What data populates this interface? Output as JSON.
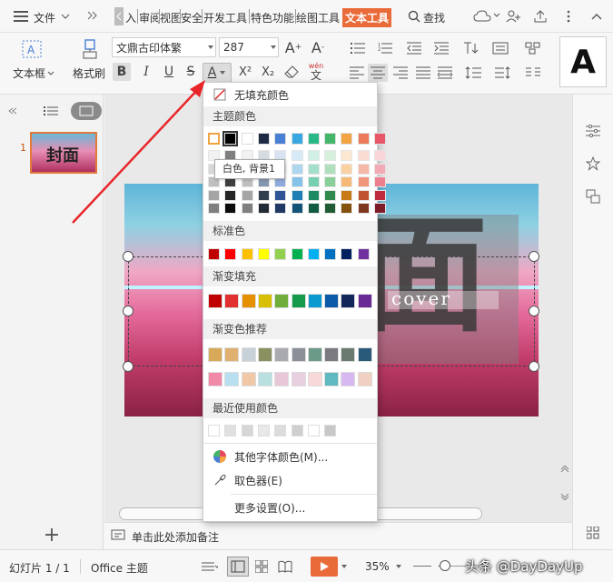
{
  "menubar": {
    "file_label": "文件",
    "tabs": [
      "入",
      "审阅",
      "视图",
      "安全",
      "开发工具",
      "特色功能",
      "绘图工具"
    ],
    "active_tab": "文本工具",
    "search_label": "查找"
  },
  "ribbon": {
    "textbox_label": "文本框",
    "format_painter_label": "格式刷",
    "font_name": "文鼎古印体繁",
    "font_size": "287",
    "bold": "B",
    "italic": "I",
    "underline": "U",
    "strike": "S",
    "font_color": "A",
    "superscript": "X²",
    "subscript": "X₂",
    "big_letter": "A",
    "phonetic": "wén"
  },
  "slide_panel": {
    "slide_number": "1",
    "thumb_text": "封面"
  },
  "canvas": {
    "slide_big_text": "面",
    "cover_text": "cover"
  },
  "dropdown": {
    "no_fill_label": "无填充颜色",
    "theme_colors_label": "主题颜色",
    "standard_colors_label": "标准色",
    "gradient_fill_label": "渐变填充",
    "gradient_recommend_label": "渐变色推荐",
    "recent_colors_label": "最近使用颜色",
    "more_colors_label": "其他字体颜色(M)...",
    "eyedropper_label": "取色器(E)",
    "more_settings_label": "更多设置(O)...",
    "theme_top": [
      "#ffffff",
      "#000000",
      "#ffffff",
      "#1f2a44",
      "#4a7fd6",
      "#3aa8e0",
      "#2bb887",
      "#44b66a",
      "#f2a342",
      "#ec7a5a",
      "#e8566a"
    ],
    "theme_shades": [
      [
        "#f2f2f2",
        "#7f7f7f",
        "#f2f2f2",
        "#d6dce4",
        "#dae3f3",
        "#d6ebf7",
        "#d1efe4",
        "#d7efdd",
        "#fce8d1",
        "#fadcd3",
        "#f9d4d9"
      ],
      [
        "#d8d8d8",
        "#595959",
        "#d8d8d8",
        "#acb9ca",
        "#b4c7e7",
        "#aed7ef",
        "#a3dfca",
        "#b0dfbb",
        "#f9d1a3",
        "#f5b9a7",
        "#f3aab4"
      ],
      [
        "#bfbfbf",
        "#3f3f3f",
        "#bfbfbf",
        "#8497b0",
        "#8faadc",
        "#85c3e8",
        "#75cfb0",
        "#88cf99",
        "#f6ba76",
        "#f0967b",
        "#ee7f8f"
      ],
      [
        "#a5a5a5",
        "#262626",
        "#a5a5a5",
        "#323f4f",
        "#2f5597",
        "#1f7eb5",
        "#1d8a64",
        "#2f8a4c",
        "#c77a16",
        "#c0532f",
        "#bf2a3e"
      ],
      [
        "#7f7f7f",
        "#0c0c0c",
        "#7f7f7f",
        "#222a35",
        "#1f3864",
        "#145478",
        "#135c43",
        "#1f5c33",
        "#85510f",
        "#80371f",
        "#7f1c29"
      ]
    ],
    "standard": [
      "#c00000",
      "#ff0000",
      "#ffc000",
      "#ffff00",
      "#92d050",
      "#00b050",
      "#00b0f0",
      "#0070c0",
      "#002060",
      "#7030a0"
    ],
    "gradient": [
      "#c00000",
      "#e03030",
      "#e59000",
      "#d8c000",
      "#6fae3a",
      "#149a4a",
      "#0a9ad0",
      "#0a5aa8",
      "#13275a",
      "#6a2a95"
    ],
    "recommend_row1": [
      "#d9a95a",
      "#e0b070",
      "#c8d0d8",
      "#8a9060",
      "#a8aab0",
      "#8a8f98",
      "#6b9a88",
      "#7a7a80",
      "#6b7a70",
      "#2a5a7a"
    ],
    "recommend_row2": [
      "#f08aa8",
      "#b8e0f0",
      "#f0c8a8",
      "#b8e0e0",
      "#e8c8d8",
      "#e8d0e0",
      "#f8d8d8",
      "#60b8c0",
      "#d8b8f0",
      "#f0d0c0"
    ],
    "recent": [
      "#ffffff",
      "#e0e0e0",
      "#d6d6d6",
      "#e8e8e8",
      "#dcdcdc",
      "#cfcfcf",
      "#ffffff",
      "#c8c8c8"
    ]
  },
  "tooltip": {
    "text": "白色, 背景1"
  },
  "notes": {
    "placeholder": "单击此处添加备注"
  },
  "status": {
    "slide_info": "幻灯片 1 / 1",
    "theme": "Office 主题",
    "zoom": "35%",
    "watermark": "头条 @DayDayUp"
  }
}
